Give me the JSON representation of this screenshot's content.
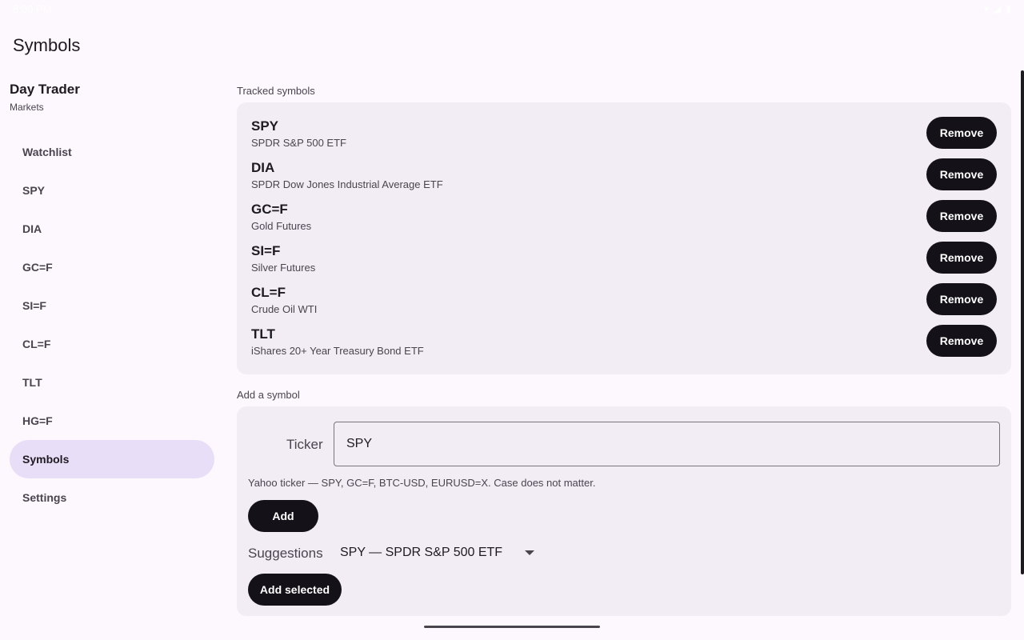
{
  "status_bar": {
    "time": "8:00 PM"
  },
  "page_title": "Symbols",
  "drawer": {
    "app_name": "Day Trader",
    "app_sub": "Markets",
    "items": [
      {
        "label": "Watchlist"
      },
      {
        "label": "SPY"
      },
      {
        "label": "DIA"
      },
      {
        "label": "GC=F"
      },
      {
        "label": "SI=F"
      },
      {
        "label": "CL=F"
      },
      {
        "label": "TLT"
      },
      {
        "label": "HG=F"
      },
      {
        "label": "Symbols",
        "active": true
      },
      {
        "label": "Settings"
      }
    ]
  },
  "tracked": {
    "label": "Tracked symbols",
    "remove_label": "Remove",
    "symbols": [
      {
        "ticker": "SPY",
        "name": "SPDR S&P 500 ETF"
      },
      {
        "ticker": "DIA",
        "name": "SPDR Dow Jones Industrial Average ETF"
      },
      {
        "ticker": "GC=F",
        "name": "Gold Futures"
      },
      {
        "ticker": "SI=F",
        "name": "Silver Futures"
      },
      {
        "ticker": "CL=F",
        "name": "Crude Oil WTI"
      },
      {
        "ticker": "TLT",
        "name": "iShares 20+ Year Treasury Bond ETF"
      }
    ]
  },
  "add": {
    "label": "Add a symbol",
    "ticker_label": "Ticker",
    "ticker_value": "SPY",
    "helper": "Yahoo ticker — SPY, GC=F, BTC-USD, EURUSD=X. Case does not matter.",
    "add_button": "Add",
    "suggestions_label": "Suggestions",
    "suggestion_selected": "SPY — SPDR S&P 500 ETF",
    "add_selected_button": "Add selected"
  },
  "colors": {
    "background": "#fdf7fe",
    "card": "#f2ecf4",
    "nav_active": "#e8def8",
    "button": "#141218"
  }
}
